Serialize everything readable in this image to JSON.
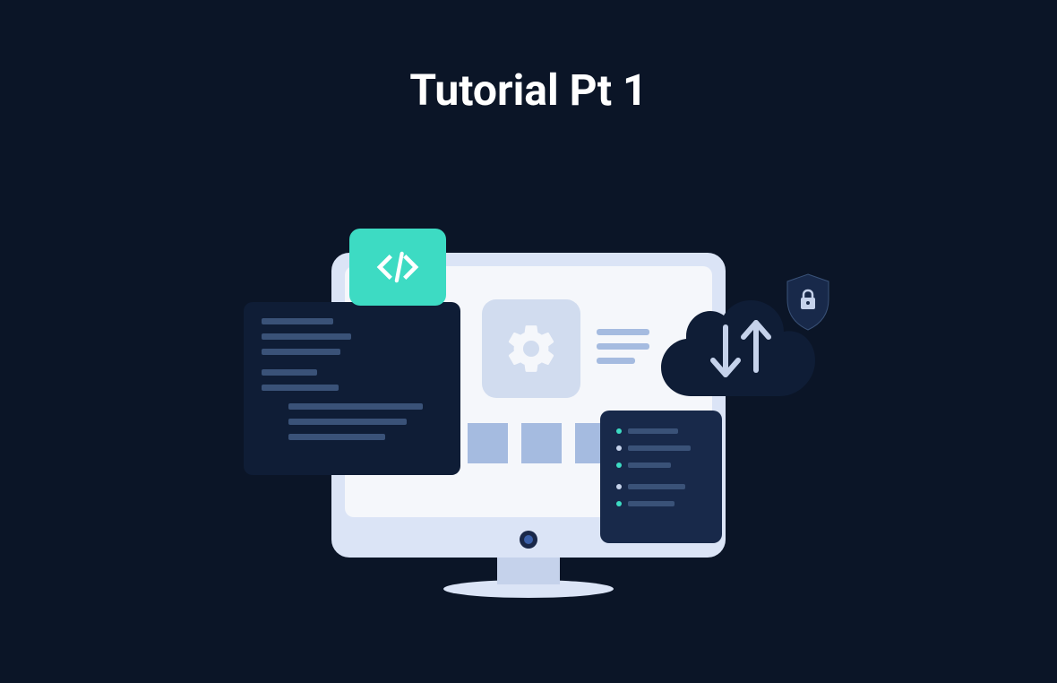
{
  "title": "Tutorial Pt 1",
  "colors": {
    "background": "#0b1527",
    "teal": "#3ddbc3",
    "lightBlue": "#dbe4f6",
    "softBlue": "#a5bbe0",
    "darkPanel": "#0f1d36",
    "midPanel": "#18294a"
  },
  "icons": {
    "code": "code-brackets",
    "gear": "settings-gear",
    "arrows": "up-down-arrows",
    "lock": "padlock",
    "shield": "security-shield"
  }
}
